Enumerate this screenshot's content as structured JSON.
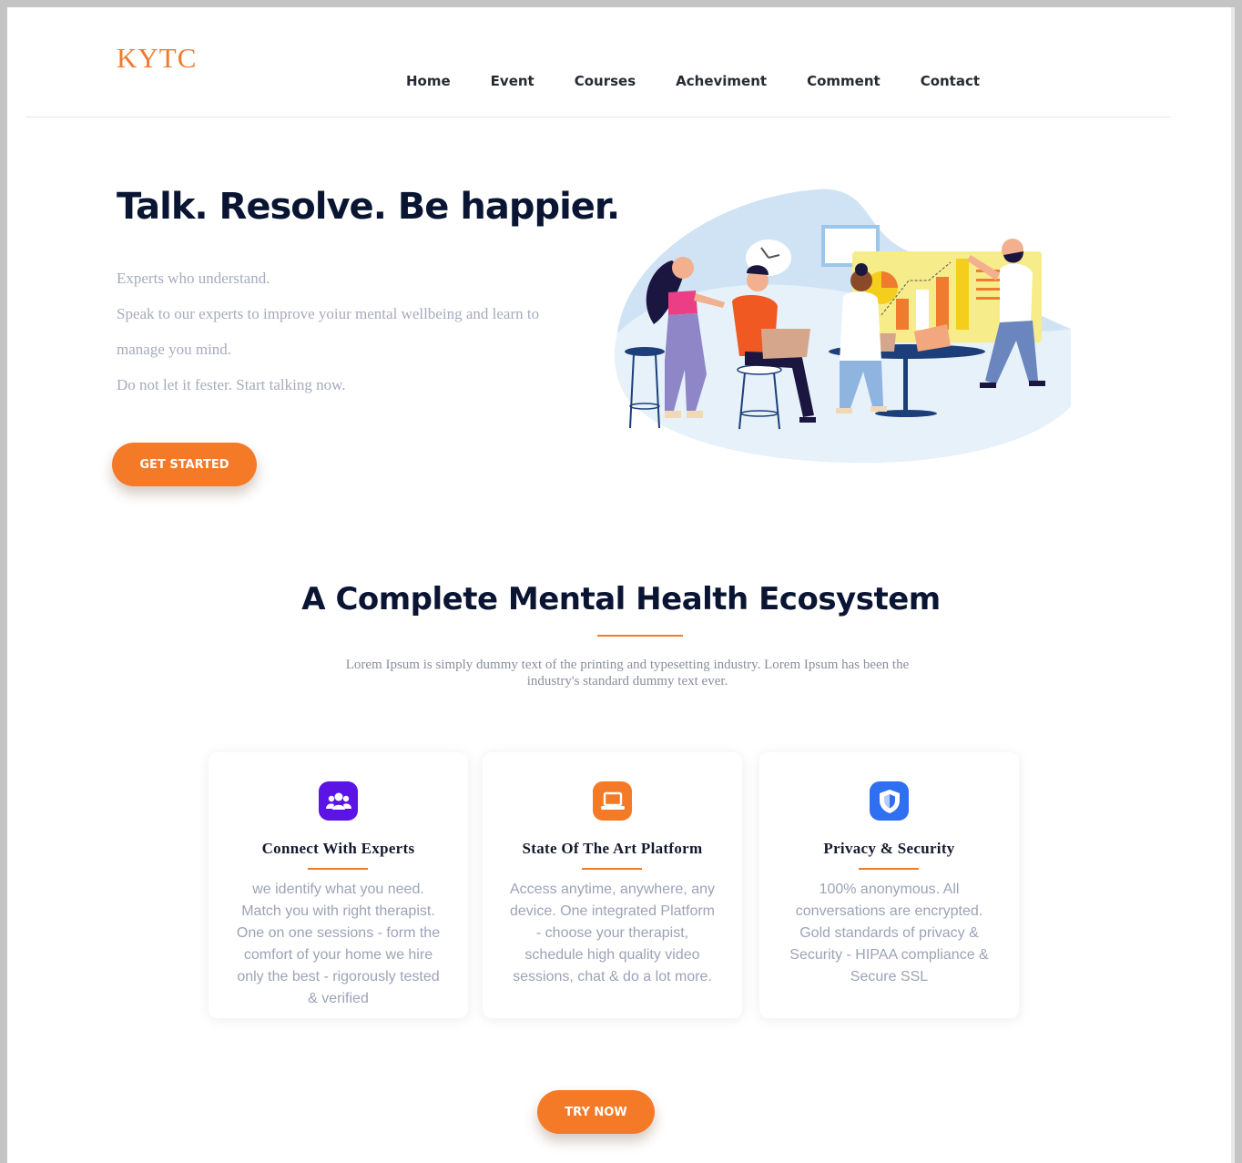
{
  "header": {
    "logo": "KYTC",
    "nav": [
      "Home",
      "Event",
      "Courses",
      "Acheviment",
      "Comment",
      "Contact"
    ]
  },
  "hero": {
    "title": "Talk. Resolve. Be happier.",
    "lines": [
      "Experts who understand.",
      "Speak to our experts to improve yoiur mental wellbeing and learn to manage you mind.",
      "Do not let it fester. Start talking now."
    ],
    "cta": "GET STARTED",
    "illustration_icon": "team-meeting-illustration"
  },
  "ecosystem": {
    "title": "A Complete Mental Health Ecosystem",
    "subtitle": "Lorem Ipsum is simply dummy text of the printing and typesetting industry. Lorem Ipsum has been the industry's standard dummy text ever.",
    "cards": [
      {
        "icon": "users-icon",
        "icon_color": "#5b13e6",
        "title": "Connect With Experts",
        "text": "we identify what you need. Match you with right therapist. One on one sessions - form the comfort of your home we hire only the best - rigorously tested & verified"
      },
      {
        "icon": "laptop-icon",
        "icon_color": "#f57a27",
        "title": "State Of The Art Platform",
        "text": "Access anytime, anywhere, any device. One integrated Platform - choose your therapist, schedule high quality video sessions, chat & do a lot more."
      },
      {
        "icon": "shield-icon",
        "icon_color": "#2f6ff2",
        "title": "Privacy & Security",
        "text": "100% anonymous. All conversations are encrypted. Gold standards of privacy & Security - HIPAA compliance & Secure SSL"
      }
    ],
    "cta": "TRY NOW"
  },
  "colors": {
    "accent": "#f57a27",
    "heading": "#0a1533",
    "muted": "#a6abbd"
  }
}
